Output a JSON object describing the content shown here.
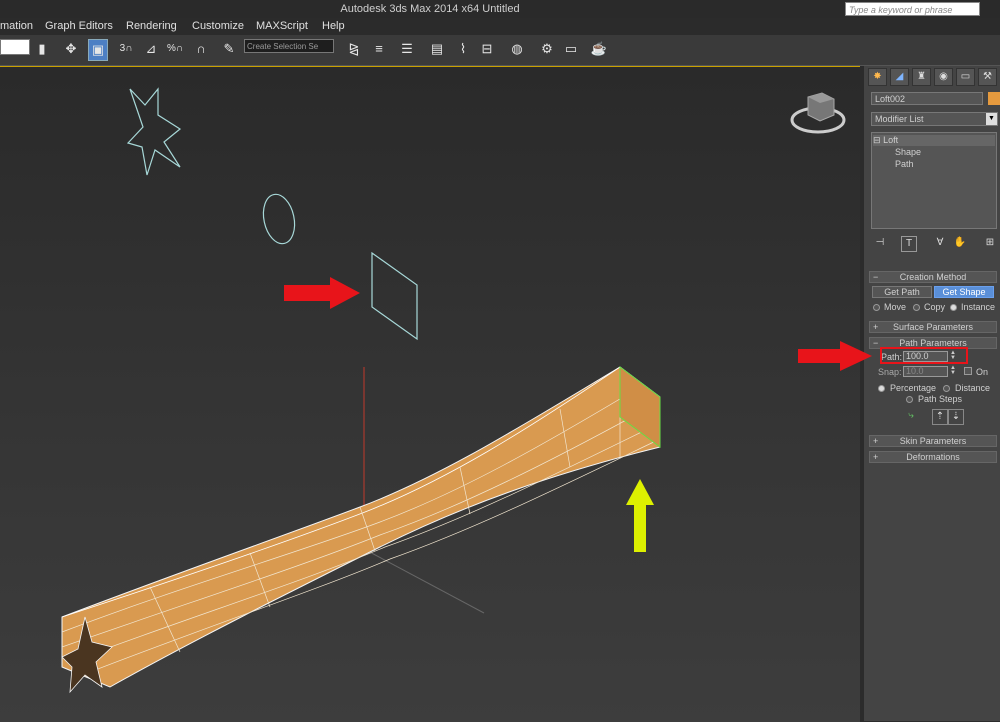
{
  "titlebar": {
    "title": "Autodesk 3ds Max  2014 x64      Untitled",
    "search_placeholder": "Type a keyword or phrase"
  },
  "menu": {
    "items": [
      "mation",
      "Graph Editors",
      "Rendering",
      "Customize",
      "MAXScript",
      "Help"
    ]
  },
  "toolbar": {
    "selection_set": "Create Selection Se",
    "snap_3d_label": "3",
    "percent_snap_label": "%"
  },
  "panel": {
    "tabs": [
      "create-icon",
      "modify-icon",
      "hierarchy-icon",
      "motion-icon",
      "display-icon",
      "utilities-icon"
    ],
    "object_name": "Loft002",
    "object_color": "#e59a3e",
    "modifier_list": "Modifier List",
    "stack": {
      "root": "Loft",
      "children": [
        "Shape",
        "Path"
      ]
    },
    "creation_method": {
      "title": "Creation Method",
      "get_path": "Get Path",
      "get_shape": "Get Shape",
      "options": [
        "Move",
        "Copy",
        "Instance"
      ],
      "selected": "Instance"
    },
    "surface_parameters": "Surface Parameters",
    "path_parameters": {
      "title": "Path Parameters",
      "path_label": "Path:",
      "path_value": "100.0",
      "snap_label": "Snap:",
      "snap_value": "10.0",
      "on_label": "On",
      "modes": [
        "Percentage",
        "Distance"
      ],
      "path_steps": "Path Steps",
      "selected": "Percentage"
    },
    "skin_parameters": "Skin Parameters",
    "deformations": "Deformations"
  },
  "colors": {
    "highlight_red": "#e8141a",
    "arrow_yellow": "#ddf000",
    "loft_fill": "#d99a50",
    "spline_cyan": "#a7d8d8",
    "active_button": "#5a8fd8"
  }
}
